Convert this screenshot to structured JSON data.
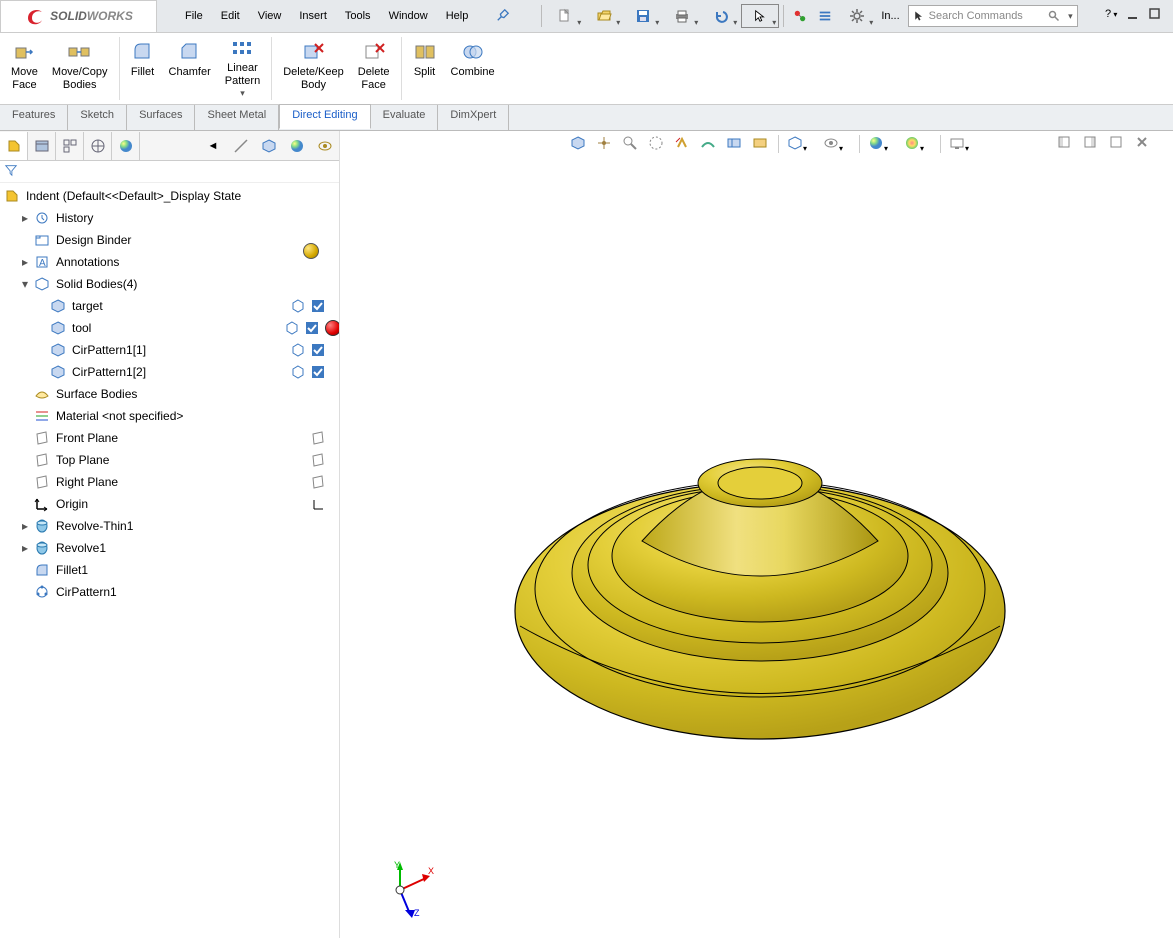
{
  "app": {
    "logo_a": "SOLID",
    "logo_b": "WORKS"
  },
  "menu": {
    "file": "File",
    "edit": "Edit",
    "view": "View",
    "insert": "Insert",
    "tools": "Tools",
    "window": "Window",
    "help": "Help"
  },
  "qat": {
    "in": "In...",
    "search_ph": "Search Commands",
    "help": "?"
  },
  "ribbon": {
    "move_face": "Move\nFace",
    "move_copy": "Move/Copy\nBodies",
    "fillet": "Fillet",
    "chamfer": "Chamfer",
    "linear": "Linear\nPattern",
    "delete_keep": "Delete/Keep\nBody",
    "delete_face": "Delete\nFace",
    "split": "Split",
    "combine": "Combine"
  },
  "tabs": {
    "features": "Features",
    "sketch": "Sketch",
    "surfaces": "Surfaces",
    "sheet": "Sheet Metal",
    "direct": "Direct Editing",
    "evaluate": "Evaluate",
    "dimxpert": "DimXpert"
  },
  "tree": {
    "root": "Indent  (Default<<Default>_Display State",
    "history": "History",
    "design_binder": "Design Binder",
    "annotations": "Annotations",
    "solid_bodies": "Solid Bodies(4)",
    "target": "target",
    "tool": "tool",
    "cir1": "CirPattern1[1]",
    "cir2": "CirPattern1[2]",
    "surface_bodies": "Surface Bodies",
    "material": "Material <not specified>",
    "front": "Front Plane",
    "top": "Top Plane",
    "right": "Right Plane",
    "origin": "Origin",
    "rev_thin": "Revolve-Thin1",
    "revolve1": "Revolve1",
    "fillet1": "Fillet1",
    "cirpattern1": "CirPattern1"
  }
}
